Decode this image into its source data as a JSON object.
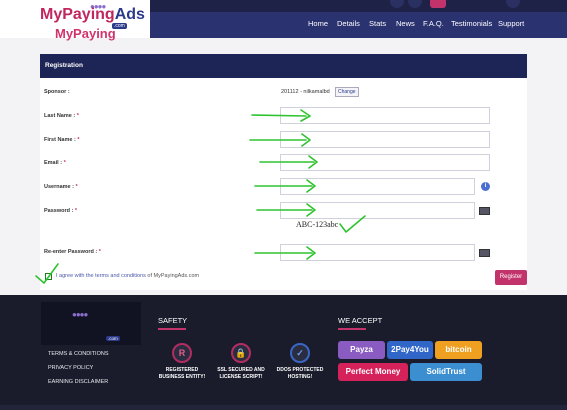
{
  "brand": {
    "name_part1": "MyPaying",
    "name_part2": "Ads",
    "suffix": ".com"
  },
  "nav": [
    "Home",
    "Details",
    "Stats",
    "News",
    "F.A.Q.",
    "Testimonials",
    "Support"
  ],
  "registration": {
    "title": "Registration",
    "sponsor_label": "Sponsor :",
    "sponsor_value": "201112 - nilkamalbd",
    "change_label": "Change",
    "fields": [
      {
        "label": "Last Name :",
        "value": ""
      },
      {
        "label": "First Name :",
        "value": ""
      },
      {
        "label": "Email :",
        "value": ""
      },
      {
        "label": "Username :",
        "value": ""
      },
      {
        "label": "Password :",
        "value": ""
      },
      {
        "label": "Re-enter Password :",
        "value": ""
      }
    ],
    "required_mark": "*",
    "captcha_text": "ABC-123abc",
    "agree_text": "I agree with the terms and conditions",
    "agree_suffix": "of MyPayingAds.com",
    "register_label": "Register"
  },
  "footer": {
    "links": [
      "TERMS & CONDITIONS",
      "PRIVACY POLICY",
      "EARNING DISCLAIMER"
    ],
    "safety_heading": "SAFETY",
    "safety_items": [
      {
        "icon": "r-icon",
        "label": "REGISTERED BUSINESS ENTITY!"
      },
      {
        "icon": "lock-icon",
        "label": "SSL SECURED AND LICENSE SCRIPT!"
      },
      {
        "icon": "shield-icon",
        "label": "DDOS PROTECTED HOSTING!"
      }
    ],
    "accept_heading": "WE ACCEPT",
    "payments": [
      "Payza",
      "2Pay4You",
      "bitcoin",
      "Perfect Money",
      "SolidTrust"
    ]
  },
  "colors": {
    "accent": "#c2336b",
    "nav": "#2a3270",
    "dark": "#1d2556",
    "annotation": "#2ec32e"
  }
}
